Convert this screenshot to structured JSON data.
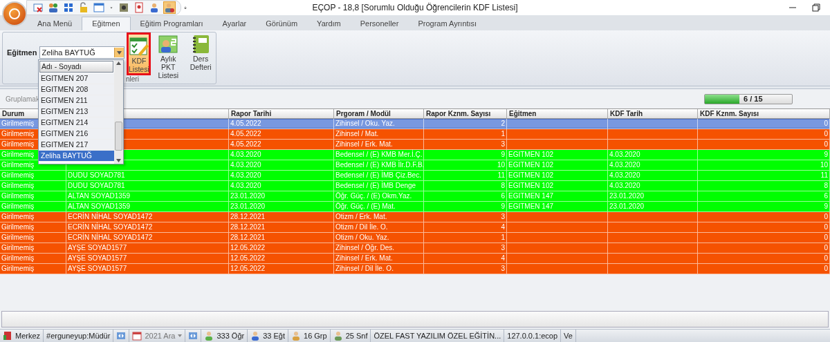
{
  "window": {
    "title": "EÇOP - 18,8 [Sorumlu Olduğu Öğrencilerin KDF Listesi]"
  },
  "tabs": [
    {
      "label": "Ana Menü",
      "selected": false
    },
    {
      "label": "Eğitmen",
      "selected": true
    },
    {
      "label": "Eğitim Programları",
      "selected": false
    },
    {
      "label": "Ayarlar",
      "selected": false
    },
    {
      "label": "Görünüm",
      "selected": false
    },
    {
      "label": "Yardım",
      "selected": false
    },
    {
      "label": "Personeller",
      "selected": false
    },
    {
      "label": "Program Ayrıntısı",
      "selected": false
    }
  ],
  "ribbon": {
    "trainer_label": "Eğitmen",
    "trainer_value": "Zeliha BAYTUĞ",
    "group_label": "nleri",
    "buttons": [
      {
        "label": "KDF Listesi",
        "selected": true
      },
      {
        "label": "Aylık PKT Listesi",
        "selected": false
      },
      {
        "label": "Ders Defteri",
        "selected": false
      }
    ]
  },
  "dropdown": {
    "header": "Adı - Soyadı",
    "items": [
      {
        "label": "EGITMEN 207",
        "selected": false
      },
      {
        "label": "EGITMEN 208",
        "selected": false
      },
      {
        "label": "EGITMEN 211",
        "selected": false
      },
      {
        "label": "EGITMEN 213",
        "selected": false
      },
      {
        "label": "EGITMEN 214",
        "selected": false
      },
      {
        "label": "EGITMEN 216",
        "selected": false
      },
      {
        "label": "EGITMEN 217",
        "selected": false
      },
      {
        "label": "Zeliha BAYTUĞ",
        "selected": true
      }
    ]
  },
  "group_hint": "Gruplamak",
  "progress": {
    "text": "6 / 15",
    "level": 0.4
  },
  "table": {
    "columns": [
      "Durum",
      "Rapor Tarihi",
      "Prgoram / Modül",
      "Rapor Kznm. Sayısı",
      "Eğitmen",
      "KDF Tarih",
      "KDF Kznm. Sayısı"
    ],
    "rows": [
      {
        "status": "Girilmemiş",
        "date": "4.05.2022",
        "program": "Zihinsel / Oku. Yaz.",
        "report_count": "2",
        "kdf_count": "0",
        "color": "#7898e0",
        "selected": true
      },
      {
        "status": "Girilmemiş",
        "date": "4.05.2022",
        "program": "Zihinsel / Mat.",
        "report_count": "1",
        "kdf_count": "0",
        "color": "#f55200",
        "selected": false
      },
      {
        "status": "Girilmemiş",
        "date": "4.05.2022",
        "program": "Zihinsel / Erk. Mat.",
        "report_count": "3",
        "kdf_count": "0",
        "color": "#f55200",
        "selected": false
      },
      {
        "status": "Girilmemiş",
        "date": "4.03.2020",
        "program": "Bedensel / (E) KMB Mer.İ.Ç.",
        "report_count": "9",
        "trainer": "EGITMEN 102",
        "kdf_date": "4.03.2020",
        "kdf_count": "9",
        "color": "#00ff00",
        "selected": false
      },
      {
        "status": "Girilmemiş",
        "date": "4.03.2020",
        "program": "Bedensel / (E) KMB İlr.D.F.B.",
        "report_count": "10",
        "trainer": "EGITMEN 102",
        "kdf_date": "4.03.2020",
        "kdf_count": "10",
        "color": "#00ff00",
        "selected": false
      },
      {
        "status": "Girilmemiş",
        "name": "DUDU SOYAD781",
        "date": "4.03.2020",
        "program": "Bedensel / (E) İMB Çiz.Bec.",
        "report_count": "11",
        "trainer": "EGITMEN 102",
        "kdf_date": "4.03.2020",
        "kdf_count": "11",
        "color": "#00ff00",
        "selected": false
      },
      {
        "status": "Girilmemiş",
        "name": "DUDU SOYAD781",
        "date": "4.03.2020",
        "program": "Bedensel / (E) İMB Denge",
        "report_count": "8",
        "trainer": "EGITMEN 102",
        "kdf_date": "4.03.2020",
        "kdf_count": "8",
        "color": "#00ff00",
        "selected": false
      },
      {
        "status": "Girilmemiş",
        "name": "ALTAN SOYAD1359",
        "date": "23.01.2020",
        "program": "Öğr. Güç. / (E) Okm.Yaz.",
        "report_count": "6",
        "trainer": "EGITMEN 147",
        "kdf_date": "23.01.2020",
        "kdf_count": "6",
        "color": "#00ff00",
        "selected": false
      },
      {
        "status": "Girilmemiş",
        "name": "ALTAN SOYAD1359",
        "date": "23.01.2020",
        "program": "Öğr. Güç. / (E) Mat.",
        "report_count": "9",
        "trainer": "EGITMEN 147",
        "kdf_date": "23.01.2020",
        "kdf_count": "9",
        "color": "#00ff00",
        "selected": false
      },
      {
        "status": "Girilmemiş",
        "name": "ECRİN NİHAL SOYAD1472",
        "date": "28.12.2021",
        "program": "Otizm / Erk. Mat.",
        "report_count": "3",
        "kdf_count": "0",
        "color": "#f55200",
        "selected": false
      },
      {
        "status": "Girilmemiş",
        "name": "ECRİN NİHAL SOYAD1472",
        "date": "28.12.2021",
        "program": "Otizm / Dil İle. O.",
        "report_count": "4",
        "kdf_count": "0",
        "color": "#f55200",
        "selected": false
      },
      {
        "status": "Girilmemiş",
        "name": "ECRİN NİHAL SOYAD1472",
        "date": "28.12.2021",
        "program": "Otizm / Oku. Yaz.",
        "report_count": "1",
        "kdf_count": "0",
        "color": "#f55200",
        "selected": false
      },
      {
        "status": "Girilmemiş",
        "name": "AYŞE SOYAD1577",
        "date": "12.05.2022",
        "program": "Zihinsel / Öğr. Des.",
        "report_count": "3",
        "kdf_count": "0",
        "color": "#f55200",
        "selected": false
      },
      {
        "status": "Girilmemiş",
        "name": "AYŞE SOYAD1577",
        "date": "12.05.2022",
        "program": "Zihinsel / Erk. Mat.",
        "report_count": "4",
        "kdf_count": "0",
        "color": "#f55200",
        "selected": false
      },
      {
        "status": "Girilmemiş",
        "name": "AYŞE SOYAD1577",
        "date": "12.05.2022",
        "program": "Zihinsel / Dil İle. O.",
        "report_count": "3",
        "kdf_count": "0",
        "color": "#f55200",
        "selected": false
      }
    ]
  },
  "status_bar": [
    {
      "kind": "text",
      "text": "Merkez"
    },
    {
      "kind": "text",
      "text": "#erguneyup:Müdür"
    },
    {
      "kind": "nav"
    },
    {
      "kind": "date",
      "text": "2021 Ara"
    },
    {
      "kind": "nav"
    },
    {
      "kind": "count",
      "text": "333 Öğr"
    },
    {
      "kind": "count",
      "text": "33 Eğt"
    },
    {
      "kind": "count",
      "text": "16 Grp"
    },
    {
      "kind": "count",
      "text": "25 Snf"
    },
    {
      "kind": "text",
      "text": "ÖZEL FAST YAZILIM ÖZEL EĞİTİN..."
    },
    {
      "kind": "text",
      "text": "127.0.0.1:ecop"
    },
    {
      "kind": "text",
      "text": "Ve"
    }
  ]
}
